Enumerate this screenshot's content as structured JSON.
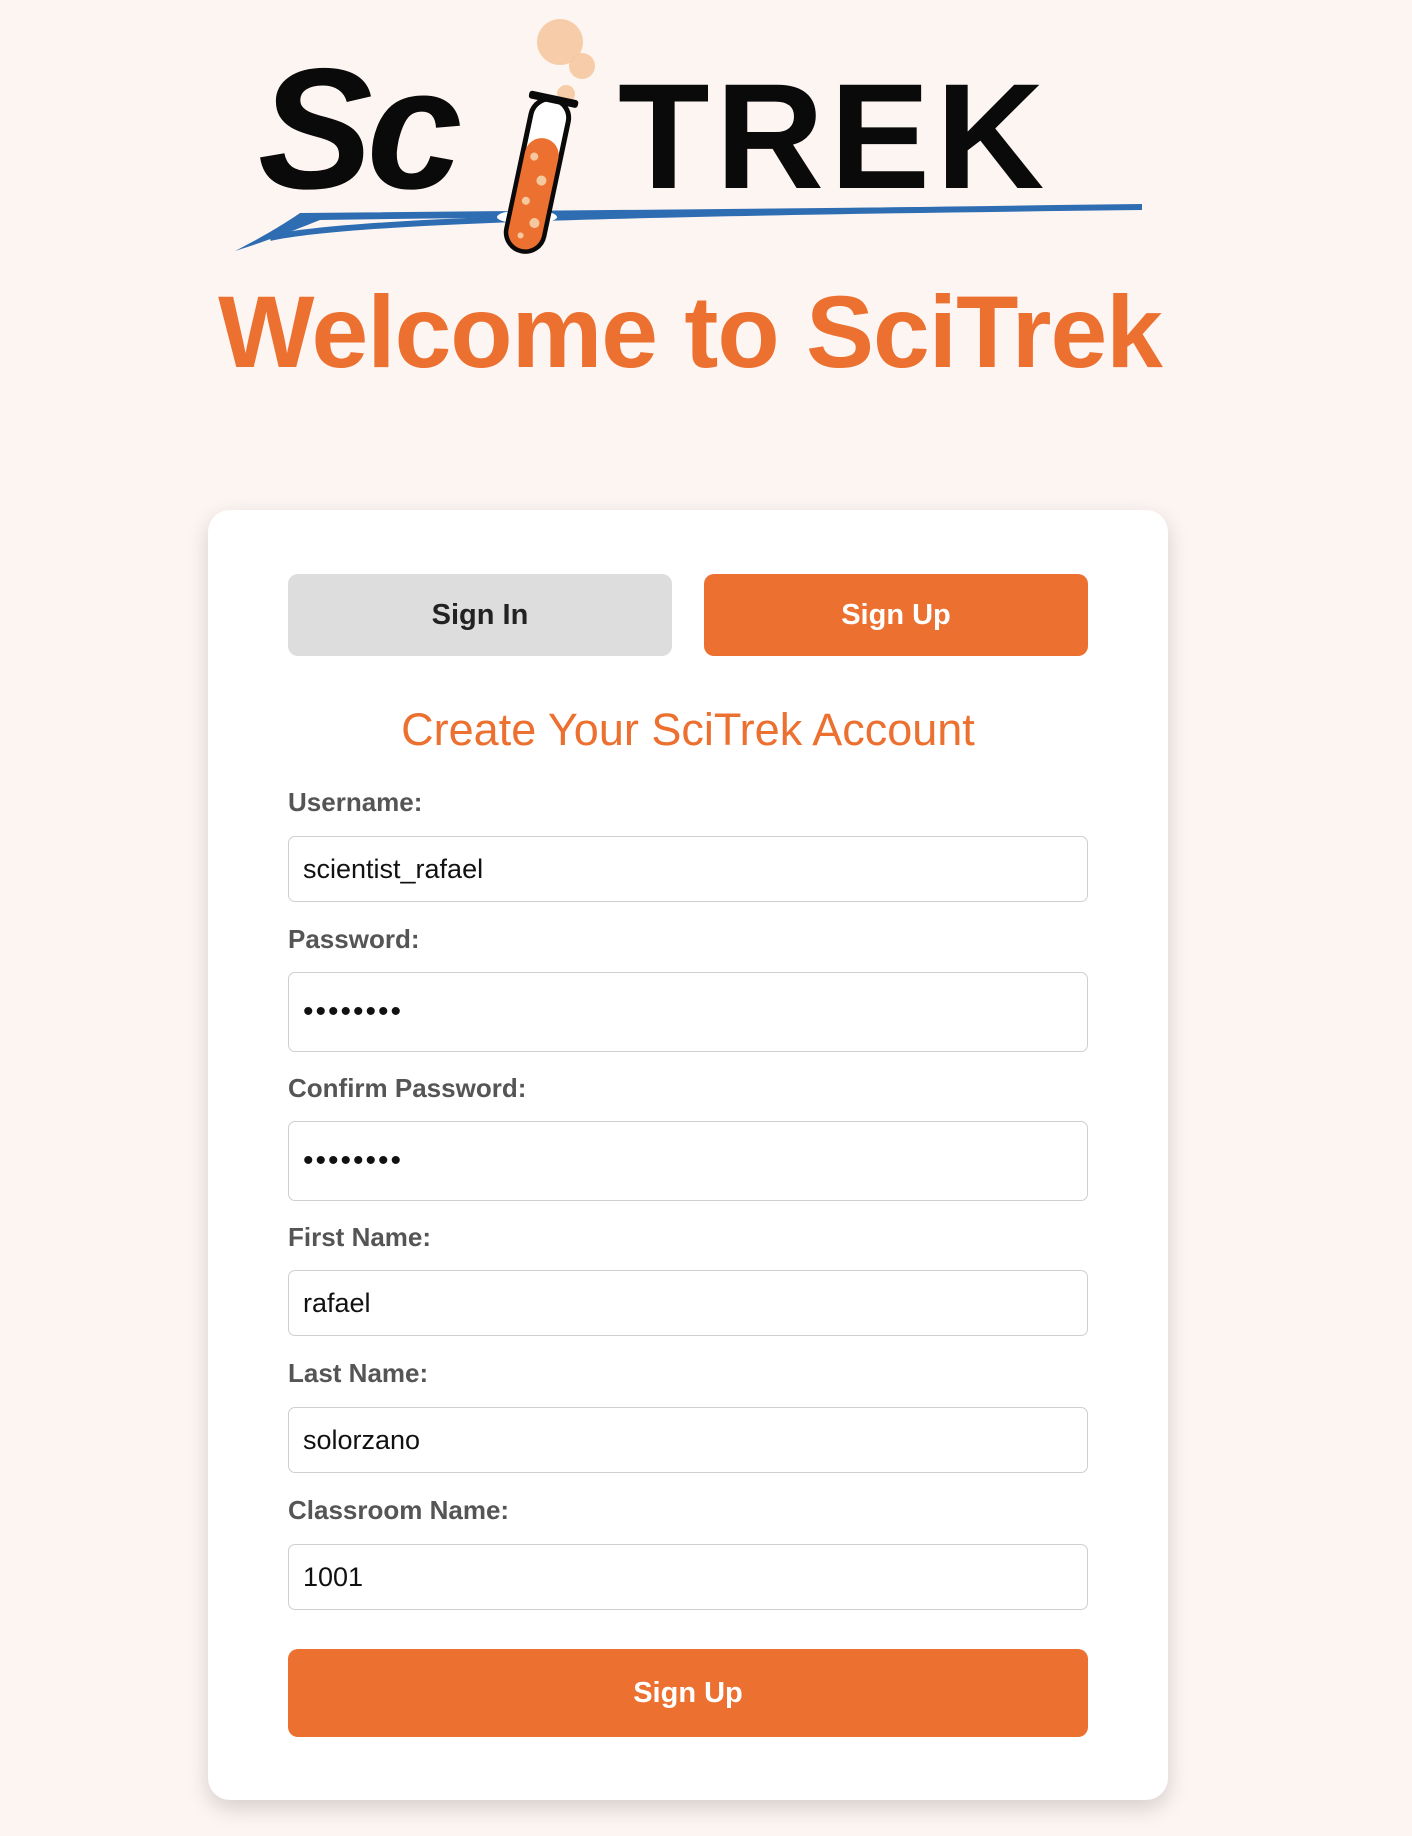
{
  "logo": {
    "text_sci": "Sc",
    "text_trek": "TREK",
    "colors": {
      "text": "#0a0a0a",
      "swoosh": "#2f6db3",
      "tube": "#ec7030",
      "bubbles": "#f5c9a0"
    }
  },
  "header": {
    "welcome": "Welcome to SciTrek"
  },
  "tabs": {
    "signin_label": "Sign In",
    "signup_label": "Sign Up",
    "active": "signup"
  },
  "form": {
    "title": "Create Your SciTrek Account",
    "fields": [
      {
        "label": "Username:",
        "value": "scientist_rafael",
        "type": "text"
      },
      {
        "label": "Password:",
        "value": "••••••••",
        "type": "password"
      },
      {
        "label": "Confirm Password:",
        "value": "••••••••",
        "type": "password"
      },
      {
        "label": "First Name:",
        "value": "rafael",
        "type": "text"
      },
      {
        "label": "Last Name:",
        "value": "solorzano",
        "type": "text"
      },
      {
        "label": "Classroom Name:",
        "value": "1001",
        "type": "text"
      }
    ],
    "submit_label": "Sign Up"
  },
  "theme": {
    "accent": "#ec7030",
    "background": "#fdf5f2",
    "card": "#ffffff",
    "inactive_tab": "#dddddd"
  }
}
